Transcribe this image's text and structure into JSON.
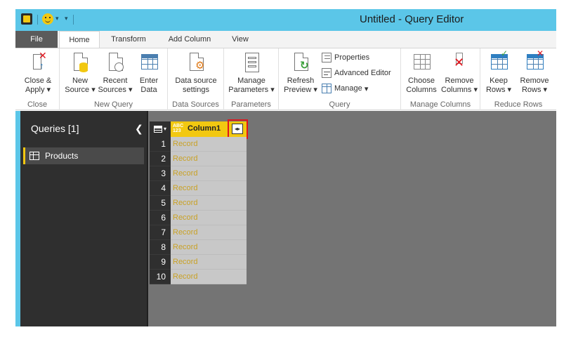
{
  "window": {
    "title": "Untitled - Query Editor",
    "accent": "#5bc6e8"
  },
  "tabs": [
    "File",
    "Home",
    "Transform",
    "Add Column",
    "View"
  ],
  "ribbon": {
    "close": {
      "close_apply": "Close &",
      "close_apply2": "Apply",
      "label": "Close"
    },
    "new_query": {
      "new_source": "New",
      "new_source2": "Source",
      "recent_sources": "Recent",
      "recent_sources2": "Sources",
      "enter_data": "Enter",
      "enter_data2": "Data",
      "label": "New Query"
    },
    "data_sources": {
      "settings": "Data source",
      "settings2": "settings",
      "label": "Data Sources"
    },
    "parameters": {
      "manage": "Manage",
      "manage2": "Parameters",
      "label": "Parameters"
    },
    "query": {
      "refresh": "Refresh",
      "refresh2": "Preview",
      "properties": "Properties",
      "advanced_editor": "Advanced Editor",
      "manage": "Manage",
      "label": "Query"
    },
    "manage_columns": {
      "choose": "Choose",
      "choose2": "Columns",
      "remove": "Remove",
      "remove2": "Columns",
      "label": "Manage Columns"
    },
    "reduce_rows": {
      "keep": "Keep",
      "keep2": "Rows",
      "remove": "Remove",
      "remove2": "Rows",
      "label": "Reduce Rows"
    }
  },
  "queries_pane": {
    "header": "Queries [1]",
    "items": [
      {
        "label": "Products"
      }
    ]
  },
  "grid": {
    "column_type": "ABC 123",
    "column_name": "Column1",
    "expand_icon": "expand-columns-icon",
    "rows": [
      {
        "num": "1",
        "value": "Record"
      },
      {
        "num": "2",
        "value": "Record"
      },
      {
        "num": "3",
        "value": "Record"
      },
      {
        "num": "4",
        "value": "Record"
      },
      {
        "num": "5",
        "value": "Record"
      },
      {
        "num": "6",
        "value": "Record"
      },
      {
        "num": "7",
        "value": "Record"
      },
      {
        "num": "8",
        "value": "Record"
      },
      {
        "num": "9",
        "value": "Record"
      },
      {
        "num": "10",
        "value": "Record"
      }
    ]
  }
}
